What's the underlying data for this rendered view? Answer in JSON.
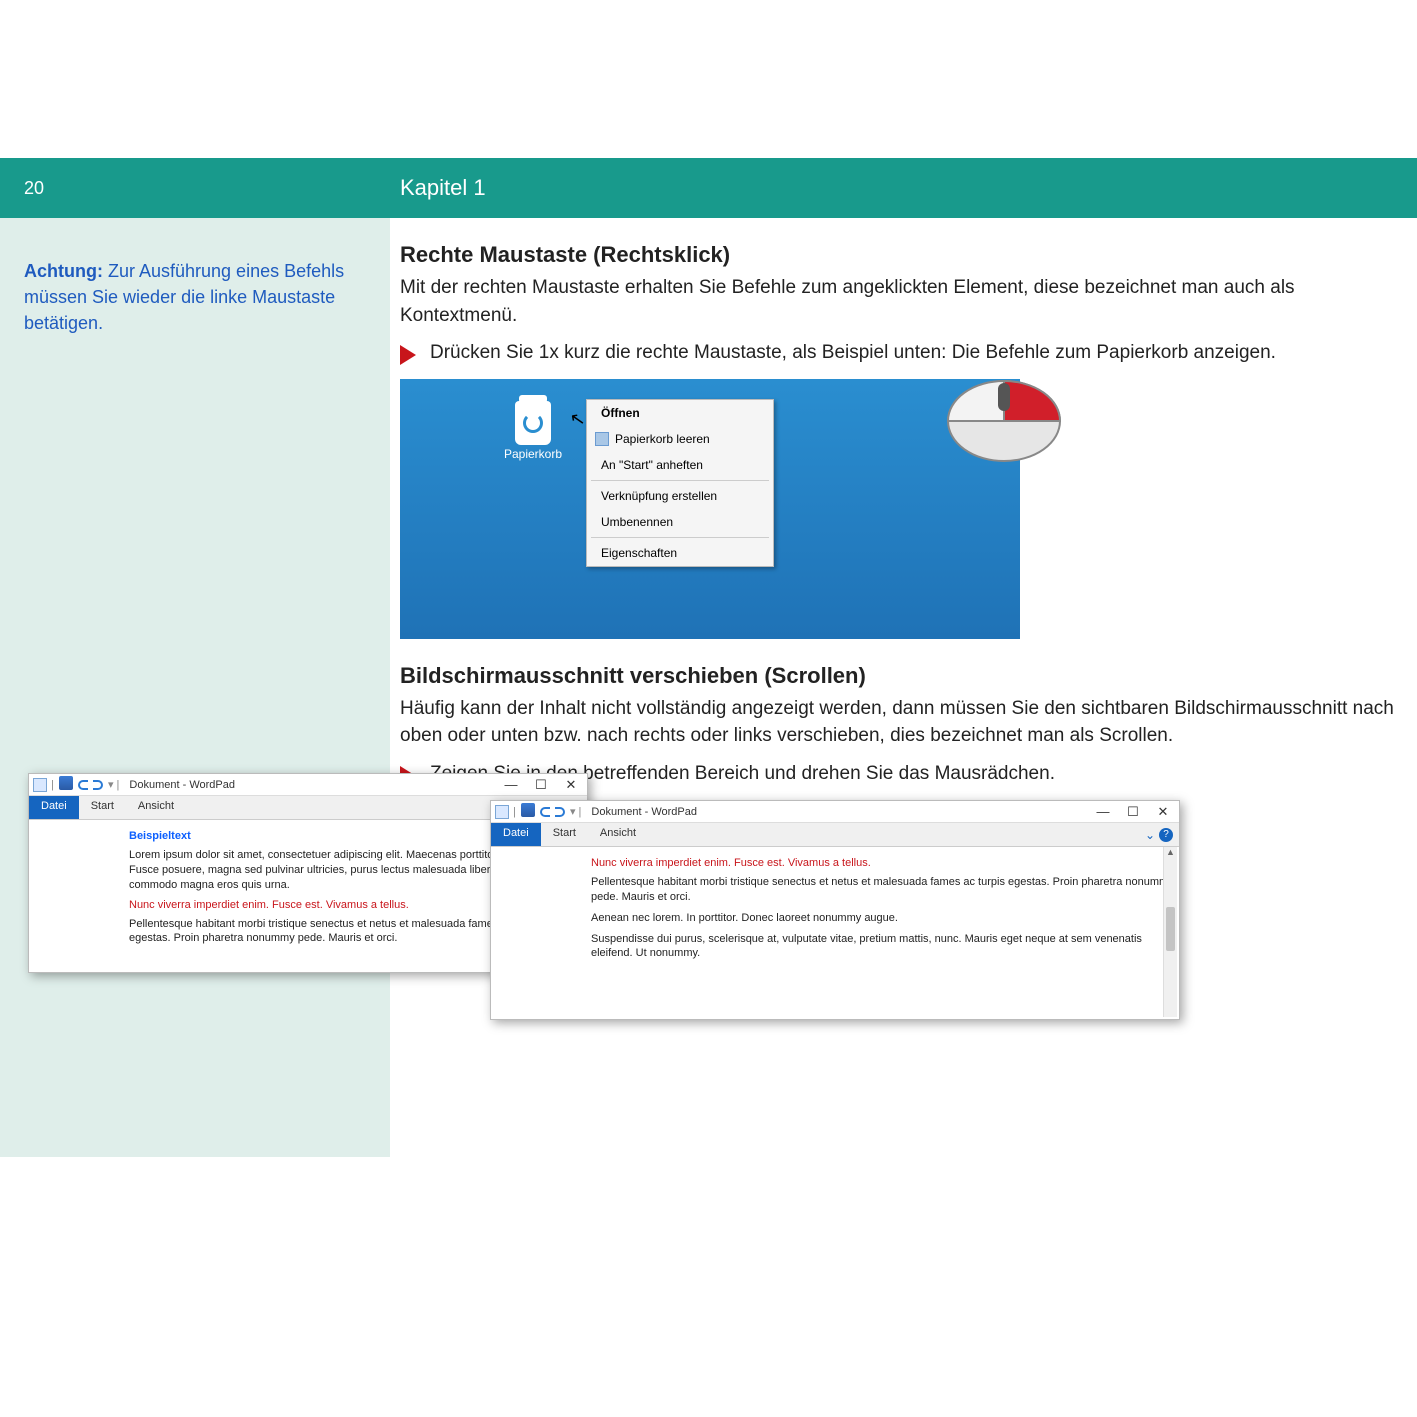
{
  "header": {
    "page": "20",
    "chapter": "Kapitel 1"
  },
  "sidebar": {
    "achtung_label": "Achtung:",
    "achtung_text": " Zur Ausführung eines Befehls müssen Sie wieder die linke Maustaste betätigen."
  },
  "section1": {
    "title": "Rechte Maustaste (Rechtsklick)",
    "body": "Mit der rechten Maustaste erhalten Sie Befehle zum angeklickten Element, diese bezeichnet man auch als Kontextmenü.",
    "bullet": "Drücken Sie 1x kurz die rechte Maustaste, als Beispiel unten: Die Befehle zum Papierkorb anzeigen."
  },
  "desktop": {
    "icon_label": "Papierkorb",
    "menu": [
      "Öffnen",
      "Papierkorb leeren",
      "An \"Start\" anheften",
      "Verknüpfung erstellen",
      "Umbenennen",
      "Eigenschaften"
    ]
  },
  "section2": {
    "title": "Bildschirmausschnitt verschieben (Scrollen)",
    "body": "Häufig kann der Inhalt nicht vollständig angezeigt werden, dann müssen Sie den sichtbaren Bildschirmausschnitt nach oben oder unten bzw. nach rechts oder links verschieben, dies bezeichnet man als Scrollen.",
    "bullet": "Zeigen Sie in den betreffenden Bereich und drehen Sie das Mausrädchen."
  },
  "wordpad": {
    "title": "Dokument - WordPad",
    "tabs": {
      "file": "Datei",
      "start": "Start",
      "view": "Ansicht"
    },
    "winctrls": {
      "min": "—",
      "max": "☐",
      "close": "✕"
    },
    "doc1": {
      "h": "Beispieltext",
      "p1": "Lorem ipsum dolor sit amet, consectetuer adipiscing elit. Maecenas porttitor congue massa. Fusce posuere, magna sed pulvinar ultricies, purus lectus malesuada libero, sit amet commodo magna eros quis urna.",
      "r": "Nunc viverra imperdiet enim. Fusce est. Vivamus a tellus.",
      "p2": "Pellentesque habitant morbi tristique senectus et netus et malesuada fames ac turpis egestas. Proin pharetra nonummy pede. Mauris et orci."
    },
    "doc2": {
      "r": "Nunc viverra imperdiet enim. Fusce est. Vivamus a tellus.",
      "p1": "Pellentesque habitant morbi tristique senectus et netus et malesuada fames ac turpis egestas. Proin pharetra nonummy pede. Mauris et orci.",
      "p2": "Aenean nec lorem. In porttitor. Donec laoreet nonummy augue.",
      "p3": "Suspendisse dui purus, scelerisque at, vulputate vitae, pretium mattis, nunc. Mauris eget neque at sem venenatis eleifend. Ut nonummy."
    }
  }
}
